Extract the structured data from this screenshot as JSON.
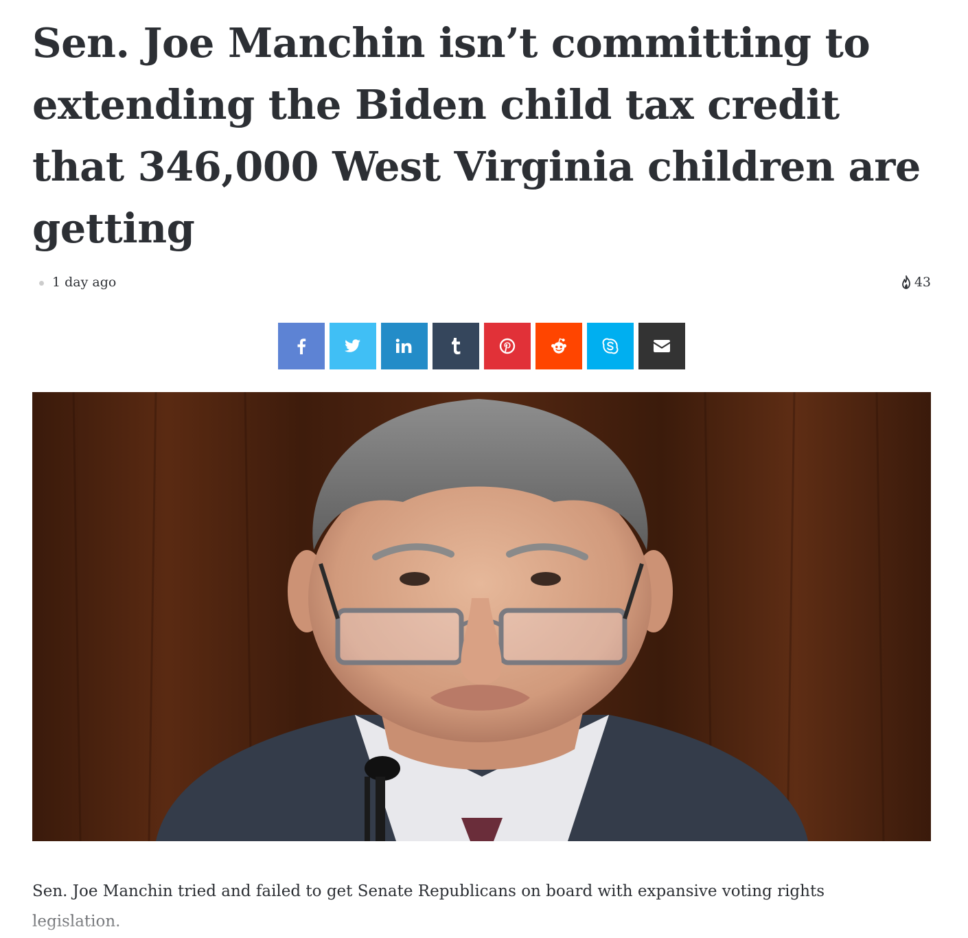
{
  "article": {
    "title": "Sen. Joe Manchin isn’t committing to extending the Biden child tax credit that 346,000 West Virginia children are getting",
    "date": "1 day ago",
    "views": "43",
    "views_icon": "fire-icon",
    "caption": "Sen. Joe Manchin tried and failed to get Senate Republicans on board with expansive voting rights legislation."
  },
  "share": {
    "buttons": [
      {
        "name": "facebook",
        "icon": "facebook-icon",
        "color": "#4080ff"
      },
      {
        "name": "twitter",
        "icon": "twitter-icon",
        "color": "#40bff5"
      },
      {
        "name": "linkedin",
        "icon": "linkedin-icon",
        "color": "#238cc8"
      },
      {
        "name": "tumblr",
        "icon": "tumblr-icon",
        "color": "#35465c"
      },
      {
        "name": "pinterest",
        "icon": "pinterest-icon",
        "color": "#e13138"
      },
      {
        "name": "reddit",
        "icon": "reddit-icon",
        "color": "#ff4500"
      },
      {
        "name": "skype",
        "icon": "skype-icon",
        "color": "#00aff0"
      },
      {
        "name": "email",
        "icon": "envelope-icon",
        "color": "#333333"
      }
    ]
  }
}
